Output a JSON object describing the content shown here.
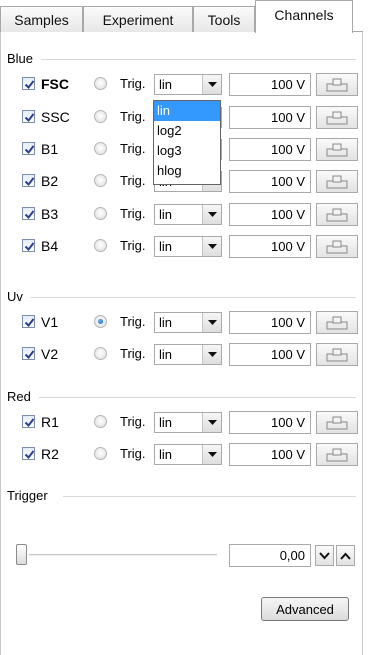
{
  "tabs": [
    {
      "label": "Samples",
      "active": false
    },
    {
      "label": "Experiment",
      "active": false
    },
    {
      "label": "Tools",
      "active": false
    },
    {
      "label": "Channels",
      "active": true
    }
  ],
  "groups": {
    "blue": "Blue",
    "uv": "Uv",
    "red": "Red",
    "trigger": "Trigger"
  },
  "trig_label": "Trig.",
  "channels": [
    {
      "name": "FSC",
      "checked": true,
      "bold": true,
      "trigger": false,
      "scale": "lin",
      "voltage": "100 V"
    },
    {
      "name": "SSC",
      "checked": true,
      "bold": false,
      "trigger": false,
      "scale": "lin",
      "voltage": "100 V"
    },
    {
      "name": "B1",
      "checked": true,
      "bold": false,
      "trigger": false,
      "scale": "lin",
      "voltage": "100 V"
    },
    {
      "name": "B2",
      "checked": true,
      "bold": false,
      "trigger": false,
      "scale": "lin",
      "voltage": "100 V"
    },
    {
      "name": "B3",
      "checked": true,
      "bold": false,
      "trigger": false,
      "scale": "lin",
      "voltage": "100 V"
    },
    {
      "name": "B4",
      "checked": true,
      "bold": false,
      "trigger": false,
      "scale": "lin",
      "voltage": "100 V"
    },
    {
      "name": "V1",
      "checked": true,
      "bold": false,
      "trigger": true,
      "scale": "lin",
      "voltage": "100 V"
    },
    {
      "name": "V2",
      "checked": true,
      "bold": false,
      "trigger": false,
      "scale": "lin",
      "voltage": "100 V"
    },
    {
      "name": "R1",
      "checked": true,
      "bold": false,
      "trigger": false,
      "scale": "lin",
      "voltage": "100 V"
    },
    {
      "name": "R2",
      "checked": true,
      "bold": false,
      "trigger": false,
      "scale": "lin",
      "voltage": "100 V"
    }
  ],
  "scale_dropdown": {
    "open_for": "FSC",
    "options": [
      "lin",
      "log2",
      "log3",
      "hlog"
    ],
    "highlighted": "lin"
  },
  "trigger": {
    "slider_level": 0,
    "value": "0,00"
  },
  "advanced_button": "Advanced",
  "colors": {
    "selection": "#3399ff",
    "radio_selected": "#1f5fb5",
    "checkmark": "#2b3f8f"
  }
}
